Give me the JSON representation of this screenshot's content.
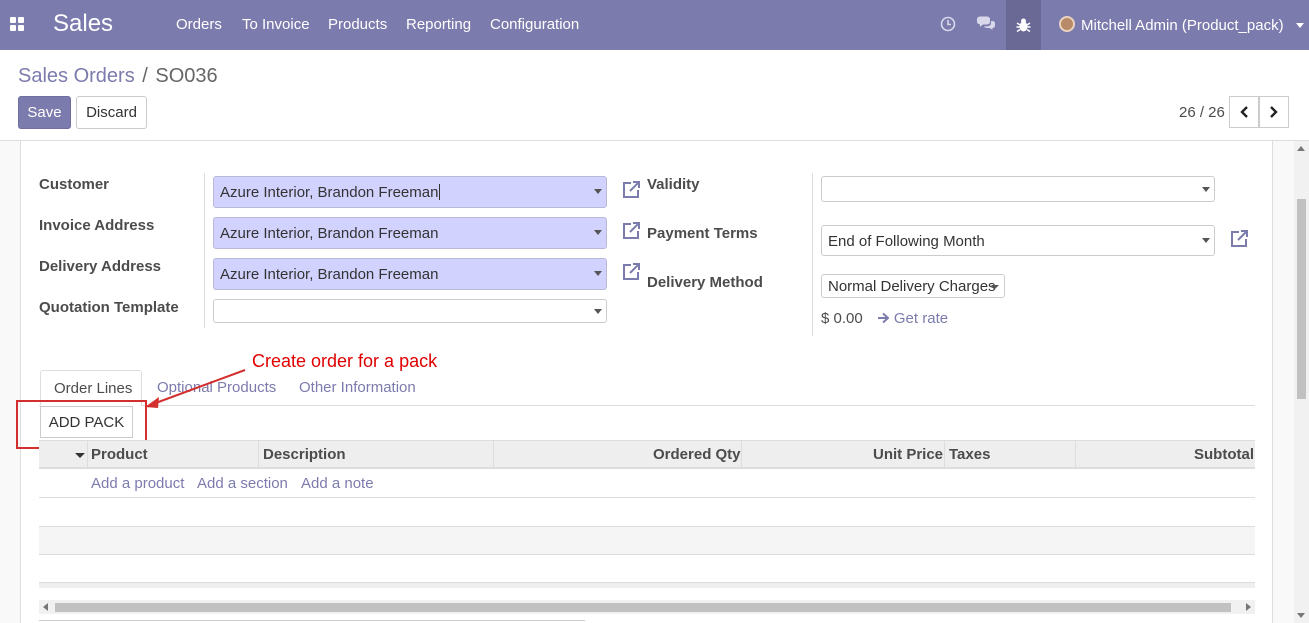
{
  "navbar": {
    "app_name": "Sales",
    "menu": [
      "Orders",
      "To Invoice",
      "Products",
      "Reporting",
      "Configuration"
    ],
    "icons": [
      "apps-icon",
      "clock-icon",
      "chat-icon",
      "bug-icon"
    ],
    "user": "Mitchell Admin (Product_pack)",
    "accent_color": "#7c7bad"
  },
  "control": {
    "breadcrumb_parent": "Sales Orders",
    "breadcrumb_separator": "/",
    "breadcrumb_current": "SO036",
    "save_label": "Save",
    "discard_label": "Discard",
    "pager": "26 / 26"
  },
  "form": {
    "customer_label": "Customer",
    "customer_value": "Azure Interior, Brandon Freeman",
    "invoice_address_label": "Invoice Address",
    "invoice_address_value": "Azure Interior, Brandon Freeman",
    "delivery_address_label": "Delivery Address",
    "delivery_address_value": "Azure Interior, Brandon Freeman",
    "quotation_template_label": "Quotation Template",
    "quotation_template_value": "",
    "validity_label": "Validity",
    "validity_value": "",
    "payment_terms_label": "Payment Terms",
    "payment_terms_value": "End of Following Month",
    "delivery_method_label": "Delivery Method",
    "delivery_method_value": "Normal Delivery Charges",
    "delivery_price": "$ 0.00",
    "get_rate_label": "Get rate"
  },
  "tabs": [
    "Order Lines",
    "Optional Products",
    "Other Information"
  ],
  "annotation": {
    "text": "Create order for a pack",
    "color": "#e00000"
  },
  "order_lines": {
    "add_pack_label": "ADD PACK",
    "columns": [
      "Product",
      "Description",
      "Ordered Qty",
      "Unit Price",
      "Taxes",
      "Subtotal"
    ],
    "add_product": "Add a product",
    "add_section": "Add a section",
    "add_note": "Add a note"
  }
}
